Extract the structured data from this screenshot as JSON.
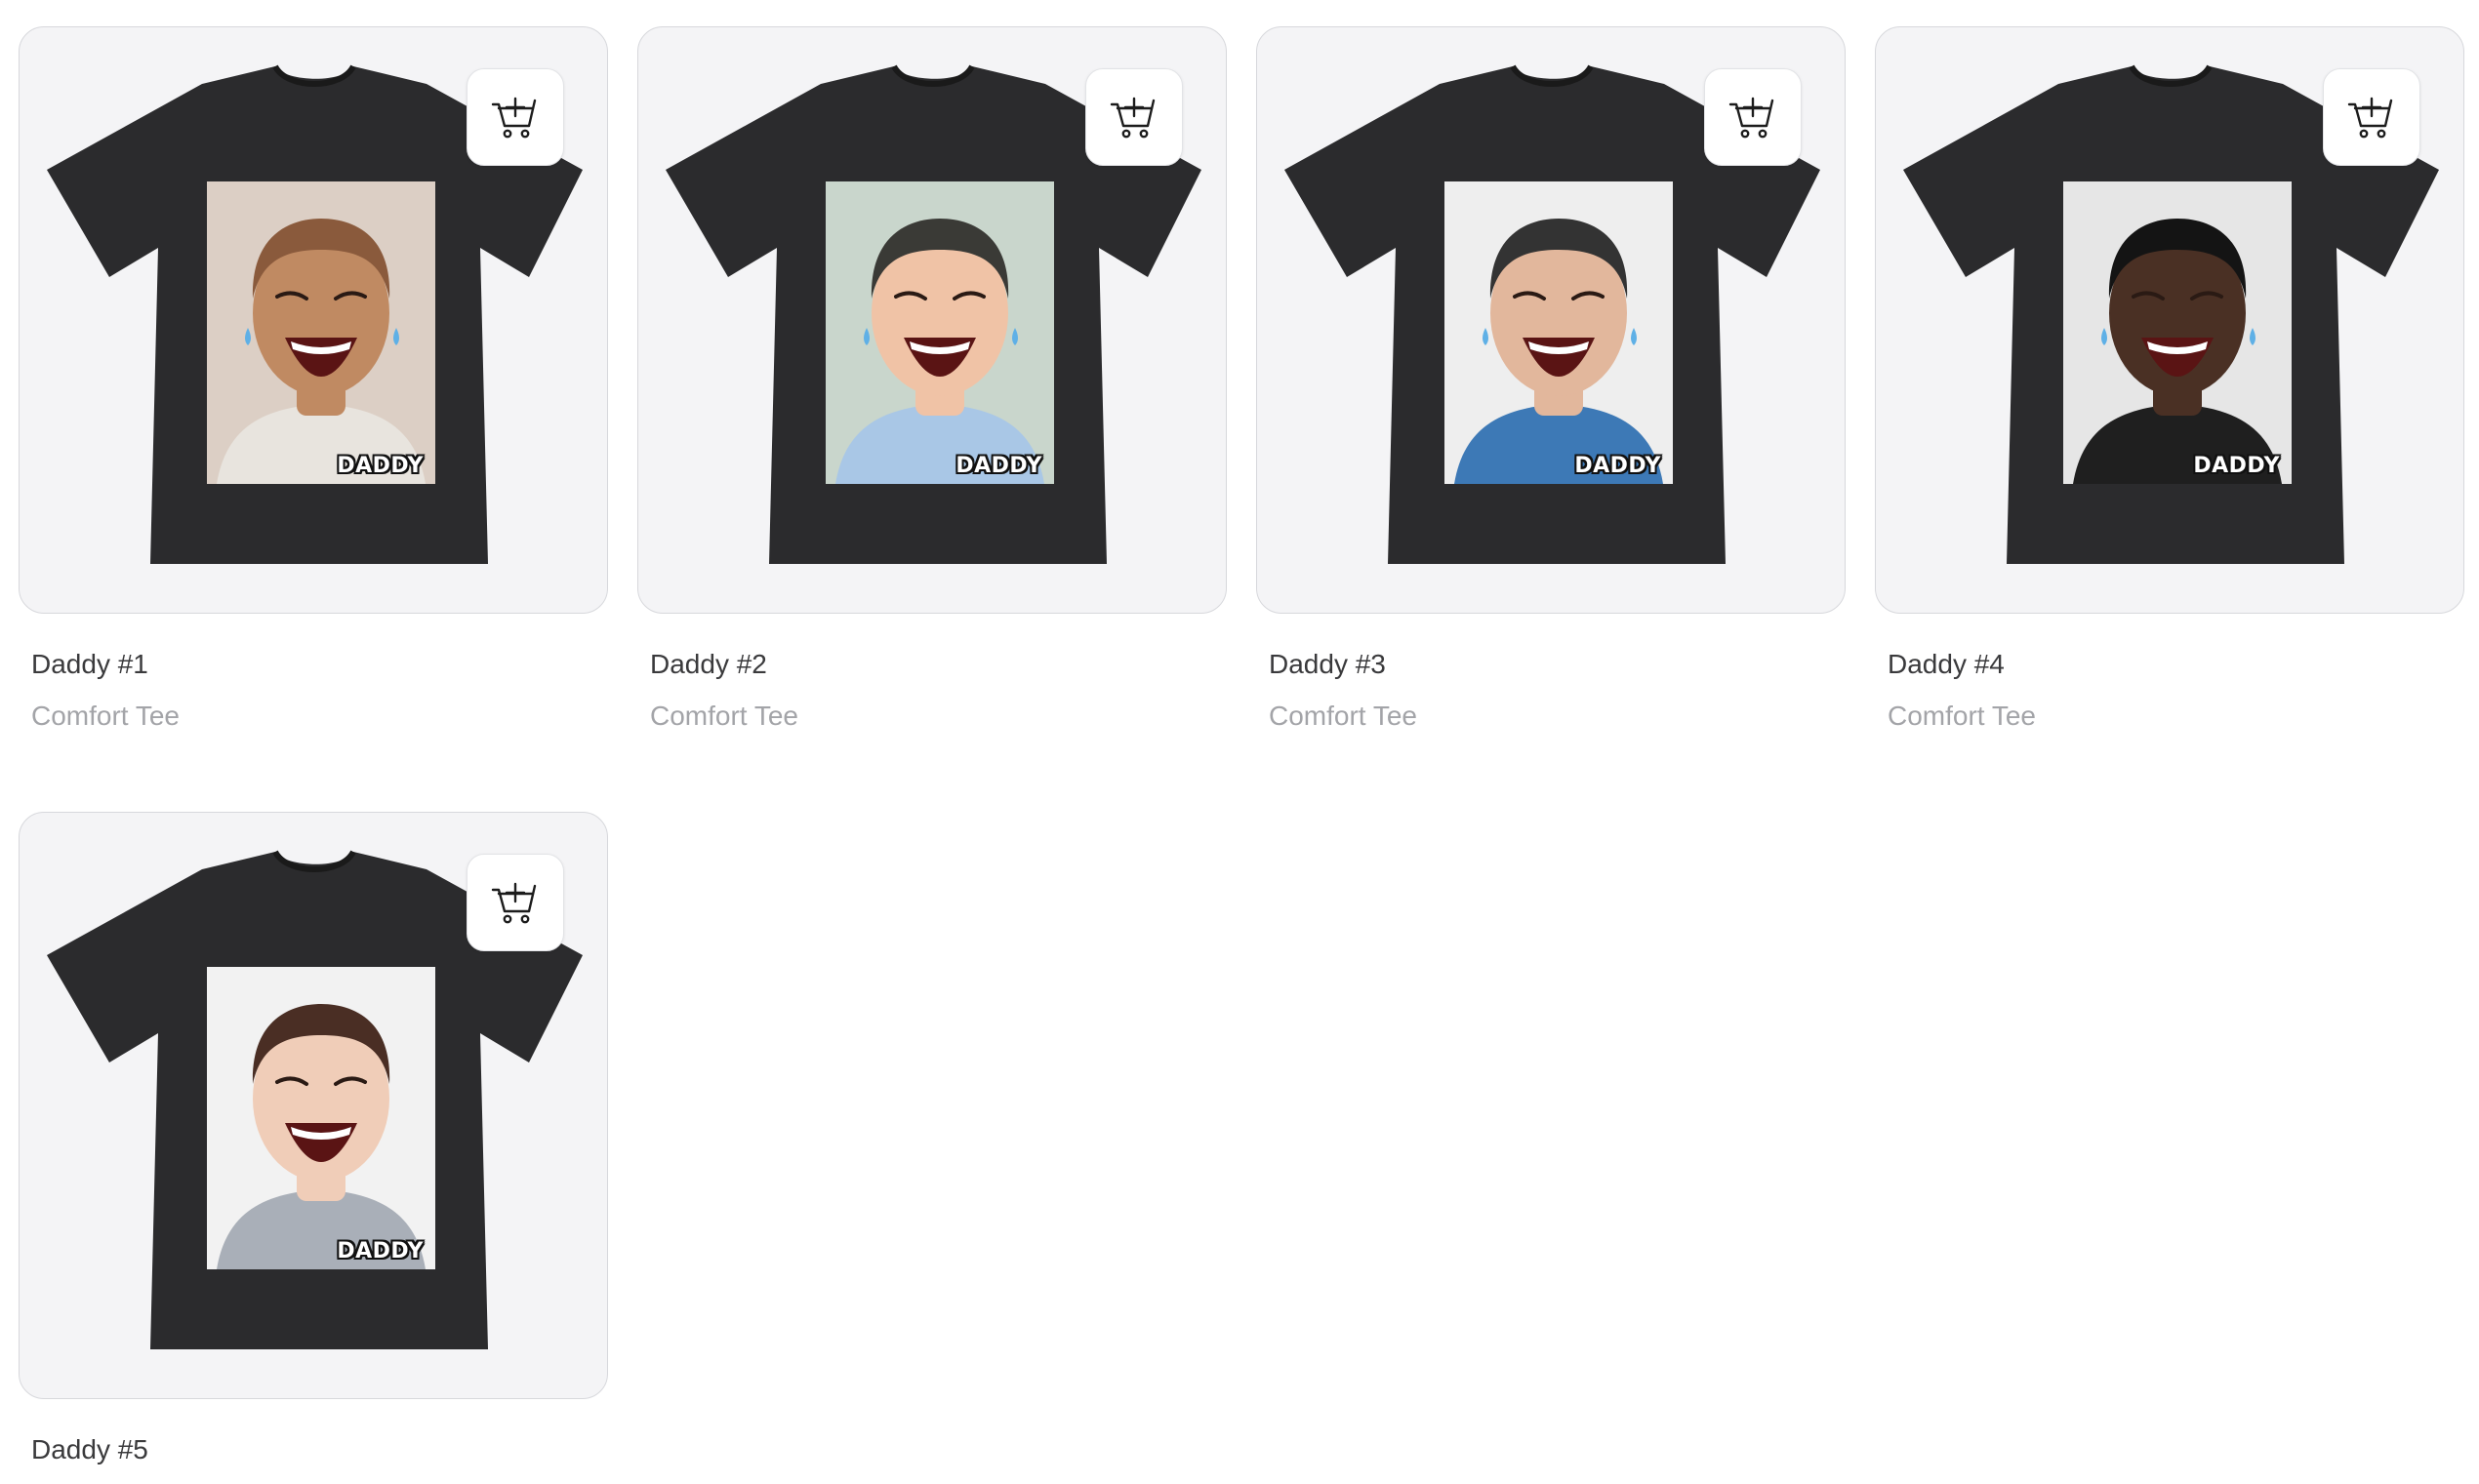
{
  "products": [
    {
      "title": "Daddy #1",
      "subtitle": "Comfort Tee",
      "print_label": "DADDY",
      "shirt_color": "#2b2b2d",
      "print_bg": "#dccfc5",
      "skin": "#c08a62",
      "hair": "#8a5a3c",
      "shirt_detail": "#e8e4de",
      "tears": true,
      "cart_icon": "add-to-cart-icon"
    },
    {
      "title": "Daddy #2",
      "subtitle": "Comfort Tee",
      "print_label": "DADDY",
      "shirt_color": "#2b2b2d",
      "print_bg": "#c9d6cc",
      "skin": "#f0c3a6",
      "hair": "#3a3a36",
      "shirt_detail": "#a9c7e6",
      "tears": true,
      "cart_icon": "add-to-cart-icon"
    },
    {
      "title": "Daddy #3",
      "subtitle": "Comfort Tee",
      "print_label": "DADDY",
      "shirt_color": "#2b2b2d",
      "print_bg": "#eeeeee",
      "skin": "#e2b79c",
      "hair": "#333333",
      "shirt_detail": "#3d79b6",
      "tears": true,
      "cart_icon": "add-to-cart-icon"
    },
    {
      "title": "Daddy #4",
      "subtitle": "Comfort Tee",
      "print_label": "DADDY",
      "shirt_color": "#2b2b2d",
      "print_bg": "#e6e6e6",
      "skin": "#4a3024",
      "hair": "#141414",
      "shirt_detail": "#1f1f1f",
      "tears": true,
      "cart_icon": "add-to-cart-icon"
    },
    {
      "title": "Daddy #5",
      "subtitle": "",
      "print_label": "DADDY",
      "shirt_color": "#2b2b2d",
      "print_bg": "#f2f2f2",
      "skin": "#f0cdb8",
      "hair": "#4a2e24",
      "shirt_detail": "#a9afb8",
      "tears": false,
      "cart_icon": "add-to-cart-icon"
    }
  ]
}
